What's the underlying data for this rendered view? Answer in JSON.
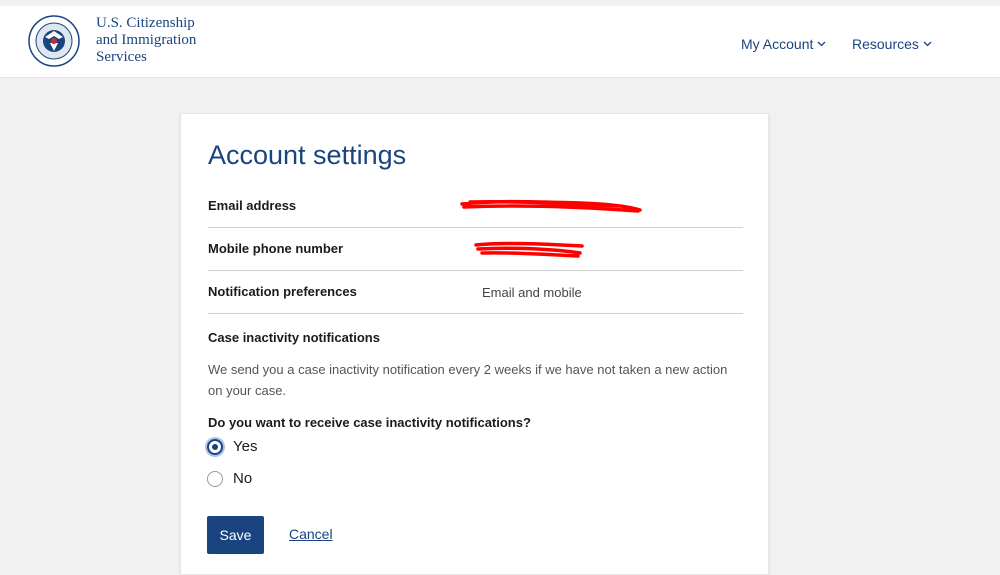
{
  "header": {
    "agency_lines": [
      "U.S. Citizenship",
      "and Immigration",
      "Services"
    ],
    "nav": [
      {
        "label": "My Account"
      },
      {
        "label": "Resources"
      }
    ]
  },
  "page": {
    "title": "Account settings",
    "rows": [
      {
        "label": "Email address",
        "value": ""
      },
      {
        "label": "Mobile phone number",
        "value": ""
      },
      {
        "label": "Notification preferences",
        "value": "Email and mobile"
      }
    ],
    "section_title": "Case inactivity notifications",
    "description": "We send you a case inactivity notification every 2 weeks if we have not taken a new action on your case.",
    "question": "Do you want to receive case inactivity notifications?",
    "options": [
      {
        "label": "Yes",
        "checked": true
      },
      {
        "label": "No",
        "checked": false
      }
    ],
    "save_label": "Save",
    "cancel_label": "Cancel"
  },
  "colors": {
    "brand": "#1a4480",
    "redaction": "#ff0000"
  }
}
